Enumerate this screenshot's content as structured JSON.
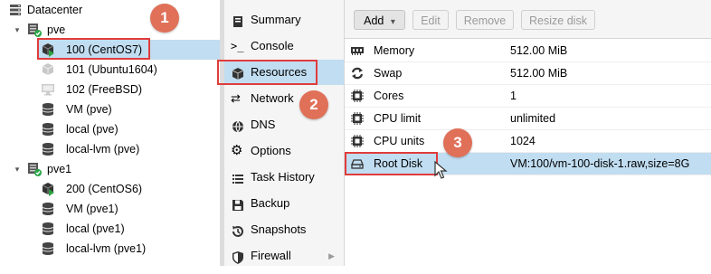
{
  "tree": {
    "datacenter": "Datacenter",
    "nodes": [
      {
        "label": "pve",
        "children": [
          "100 (CentOS7)",
          "101 (Ubuntu1604)",
          "102 (FreeBSD)",
          "VM (pve)",
          "local (pve)",
          "local-lvm (pve)"
        ]
      },
      {
        "label": "pve1",
        "children": [
          "200 (CentOS6)",
          "VM (pve1)",
          "local (pve1)",
          "local-lvm (pve1)"
        ]
      }
    ]
  },
  "nav": {
    "items": [
      "Summary",
      "Console",
      "Resources",
      "Network",
      "DNS",
      "Options",
      "Task History",
      "Backup",
      "Snapshots",
      "Firewall"
    ]
  },
  "toolbar": {
    "add": "Add",
    "add_caret": "▾",
    "edit": "Edit",
    "remove": "Remove",
    "resize": "Resize disk"
  },
  "hardware": [
    {
      "name": "Memory",
      "value": "512.00 MiB",
      "icon": "memory-icon"
    },
    {
      "name": "Swap",
      "value": "512.00 MiB",
      "icon": "swap-icon"
    },
    {
      "name": "Cores",
      "value": "1",
      "icon": "cpu-icon"
    },
    {
      "name": "CPU limit",
      "value": "unlimited",
      "icon": "cpu-icon"
    },
    {
      "name": "CPU units",
      "value": "1024",
      "icon": "cpu-icon"
    },
    {
      "name": "Root Disk",
      "value": "VM:100/vm-100-disk-1.raw,size=8G",
      "icon": "disk-icon"
    }
  ],
  "annotations": [
    "1",
    "2",
    "3"
  ],
  "colors": {
    "selection": "#c1ddf1",
    "highlight_border": "#e03c3c",
    "badge": "#e07058",
    "running_green": "#2ea043",
    "node_ok_green": "#28a745"
  }
}
